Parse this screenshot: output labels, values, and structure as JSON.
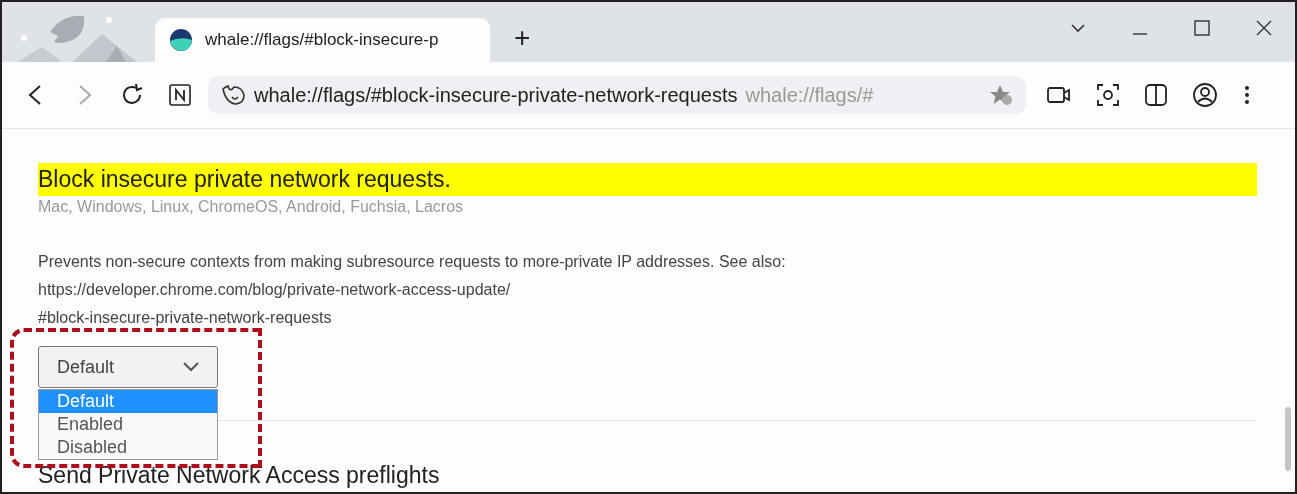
{
  "tabs": [
    {
      "title": "whale://flags/#block-insecure-p",
      "selected": true
    }
  ],
  "new_tab": "+",
  "address_bar": {
    "url": "whale://flags/#block-insecure-private-network-requests",
    "suggestion": "whale://flags/#"
  },
  "flag": {
    "title": "Block insecure private network requests.",
    "highlighted": true,
    "platforms": "Mac, Windows, Linux, ChromeOS, Android, Fuchsia, Lacros",
    "description": "Prevents non-secure contexts from making subresource requests to more-private IP addresses. See also:",
    "link": "https://developer.chrome.com/blog/private-network-access-update/",
    "anchor": "#block-insecure-private-network-requests",
    "select": {
      "value": "Default",
      "expanded": true,
      "options": [
        {
          "label": "Default",
          "selected": true
        },
        {
          "label": "Enabled",
          "selected": false
        },
        {
          "label": "Disabled",
          "selected": false
        }
      ]
    }
  },
  "next_flag": {
    "title": "Send Private Network Access preflights"
  }
}
